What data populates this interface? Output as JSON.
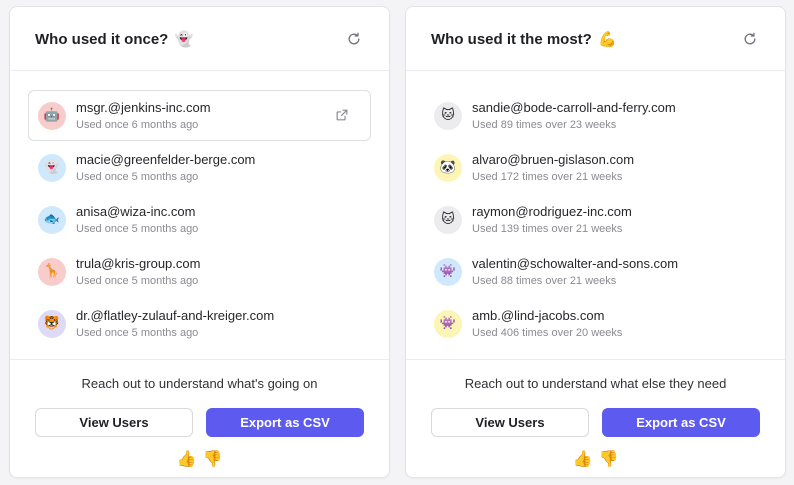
{
  "cards": [
    {
      "title": "Who used it once?",
      "title_emoji": "👻",
      "refresh_icon": "refresh-icon",
      "rows": [
        {
          "email": "msgr.@jenkins-inc.com",
          "sub": "Used once 6 months ago",
          "avatar": "🤖",
          "avatar_bg": "#f9cccc",
          "avatar_icon": "robot-avatar-icon"
        },
        {
          "email": "macie@greenfelder-berge.com",
          "sub": "Used once 5 months ago",
          "avatar": "👻",
          "avatar_bg": "#cfe8fb",
          "avatar_icon": "ghost-avatar-icon"
        },
        {
          "email": "anisa@wiza-inc.com",
          "sub": "Used once 5 months ago",
          "avatar": "🐟",
          "avatar_bg": "#cfe8fb",
          "avatar_icon": "fish-avatar-icon"
        },
        {
          "email": "trula@kris-group.com",
          "sub": "Used once 5 months ago",
          "avatar": "🦒",
          "avatar_bg": "#f9cccc",
          "avatar_icon": "giraffe-avatar-icon"
        },
        {
          "email": "dr.@flatley-zulauf-and-kreiger.com",
          "sub": "Used once 5 months ago",
          "avatar": "🐯",
          "avatar_bg": "#dcdaf7",
          "avatar_icon": "tiger-avatar-icon"
        }
      ],
      "footer_text": "Reach out to understand what's going on",
      "secondary_label": "View Users",
      "primary_label": "Export as CSV",
      "thumbs_up": "👍",
      "thumbs_down": "👎"
    },
    {
      "title": "Who used it the most?",
      "title_emoji": "💪",
      "refresh_icon": "refresh-icon",
      "rows": [
        {
          "email": "sandie@bode-carroll-and-ferry.com",
          "sub": "Used 89 times over 23 weeks",
          "avatar": "🐱",
          "avatar_bg": "#ececef",
          "avatar_icon": "cat-avatar-icon"
        },
        {
          "email": "alvaro@bruen-gislason.com",
          "sub": "Used 172 times over 21 weeks",
          "avatar": "🐼",
          "avatar_bg": "#fdf5b5",
          "avatar_icon": "panda-avatar-icon"
        },
        {
          "email": "raymon@rodriguez-inc.com",
          "sub": "Used 139 times over 21 weeks",
          "avatar": "🐱",
          "avatar_bg": "#ececef",
          "avatar_icon": "cat-avatar-icon"
        },
        {
          "email": "valentin@schowalter-and-sons.com",
          "sub": "Used 88 times over 21 weeks",
          "avatar": "👾",
          "avatar_bg": "#cfe8fb",
          "avatar_icon": "monster-avatar-icon"
        },
        {
          "email": "amb.@lind-jacobs.com",
          "sub": "Used 406 times over 20 weeks",
          "avatar": "👾",
          "avatar_bg": "#fdf5b5",
          "avatar_icon": "monster-avatar-icon"
        }
      ],
      "footer_text": "Reach out to understand what else they need",
      "secondary_label": "View Users",
      "primary_label": "Export as CSV",
      "thumbs_up": "👍",
      "thumbs_down": "👎"
    }
  ],
  "colors": {
    "primary": "#5d5af0",
    "text": "#1f2023",
    "muted": "#8a8b93",
    "border": "#e4e4e7"
  },
  "external_link_icon": "external-link-icon"
}
